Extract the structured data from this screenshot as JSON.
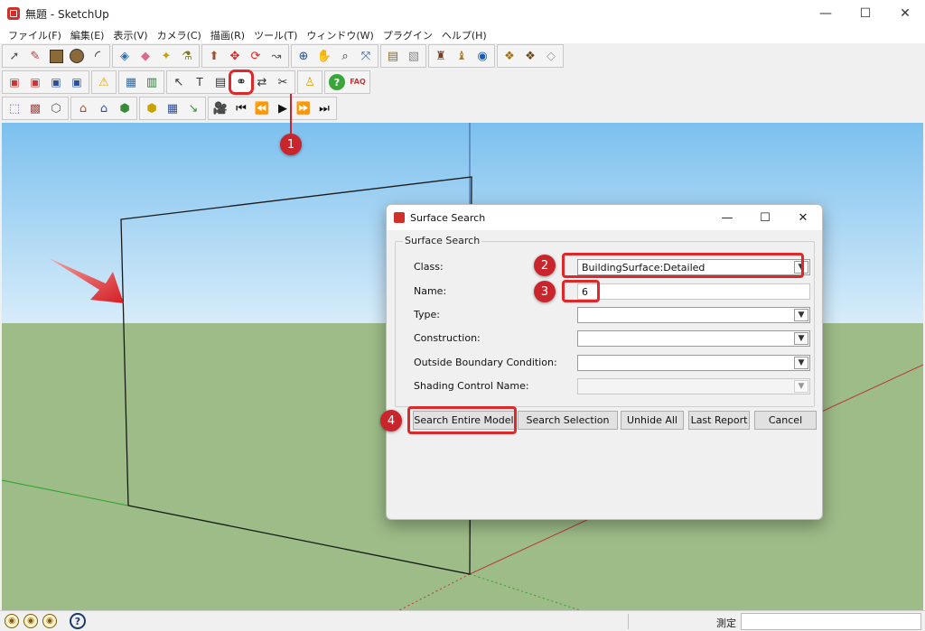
{
  "window": {
    "title": "無題 - SketchUp",
    "minimize": "—",
    "maximize": "☐",
    "close": "✕"
  },
  "menu": [
    "ファイル(F)",
    "編集(E)",
    "表示(V)",
    "カメラ(C)",
    "描画(R)",
    "ツール(T)",
    "ウィンドウ(W)",
    "プラグイン",
    "ヘルプ(H)"
  ],
  "toolbars": {
    "row1": [
      "select-icon",
      "pencil-icon",
      "rectangle-icon",
      "circle-icon",
      "arc-icon",
      "make-component-icon",
      "eraser-icon",
      "tape-measure-icon",
      "paint-bucket-icon",
      "push-pull-icon",
      "move-icon",
      "rotate-icon",
      "follow-me-icon",
      "orbit-icon",
      "pan-icon",
      "zoom-icon",
      "zoom-extents-icon",
      "get-models-icon",
      "share-model-icon",
      "component-icon",
      "share-component-icon",
      "3d-warehouse-icon",
      "extension-warehouse-icon",
      "extension-manager-icon"
    ],
    "row2": [
      "new-idf-icon",
      "open-idf-icon",
      "save-idf-icon",
      "save-as-idf-icon",
      "warning-icon",
      "inspector-icon",
      "surface-matching-icon",
      "select-surface-icon",
      "render-icon",
      "info-icon",
      "surface-search-icon",
      "swap-icon",
      "tools-icon",
      "daylight-icon",
      "help-icon",
      "faq-icon"
    ],
    "row3": [
      "zone-icon",
      "space-icon",
      "shading-icon",
      "building-icon",
      "house-icon",
      "interior-icon",
      "exterior-icon",
      "table-icon",
      "data-icon",
      "animation-icon",
      "skip-start-icon",
      "rewind-icon",
      "play-icon",
      "fast-forward-icon",
      "skip-end-icon"
    ]
  },
  "dialog": {
    "title": "Surface Search",
    "group_label": "Surface Search",
    "labels": {
      "class": "Class:",
      "name": "Name:",
      "type": "Type:",
      "construction": "Construction:",
      "outside_boundary": "Outside Boundary Condition:",
      "shading_control": "Shading Control Name:"
    },
    "values": {
      "class": "BuildingSurface:Detailed",
      "name": "6",
      "type": "",
      "construction": "",
      "outside_boundary": "",
      "shading_control": ""
    },
    "buttons": {
      "search_entire": "Search Entire Model",
      "search_selection": "Search Selection",
      "unhide_all": "Unhide All",
      "last_report": "Last Report",
      "cancel": "Cancel"
    },
    "dropdown_arrow": "▼"
  },
  "callouts": [
    "1",
    "2",
    "3",
    "4"
  ],
  "status": {
    "measure_label": "測定",
    "measure_value": "",
    "help": "?"
  },
  "colors": {
    "highlight": "#e0282a",
    "callout": "#c8262c",
    "sky": "#7cc0ee",
    "ground": "#9dbc88"
  }
}
